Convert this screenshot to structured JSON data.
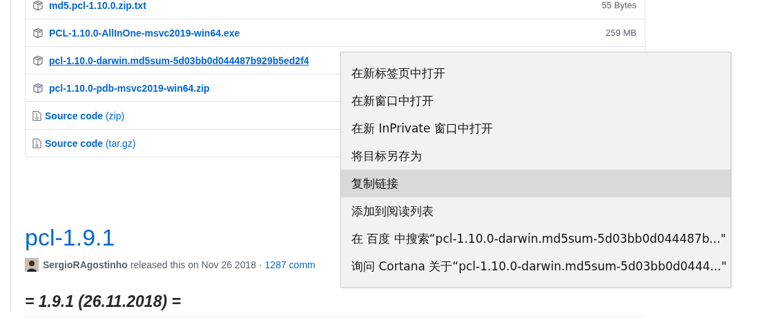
{
  "assets": [
    {
      "kind": "package",
      "name": "md5.pcl-1.10.0.zip.txt",
      "size": "55 Bytes",
      "underlined": false
    },
    {
      "kind": "package",
      "name": "PCL-1.10.0-AllInOne-msvc2019-win64.exe",
      "size": "259 MB",
      "underlined": false
    },
    {
      "kind": "package",
      "name": "pcl-1.10.0-darwin.md5sum-5d03bb0d044487b929b5ed2f4",
      "underlined": true
    },
    {
      "kind": "package",
      "name": "pcl-1.10.0-pdb-msvc2019-win64.zip",
      "underlined": false
    },
    {
      "kind": "source",
      "name": "Source code",
      "format": "(zip)",
      "underlined": false
    },
    {
      "kind": "source",
      "name": "Source code",
      "format": "(tar.gz)",
      "underlined": false
    }
  ],
  "release": {
    "title": "pcl-1.9.1",
    "author": "SergioRAgostinho",
    "released": "released this on Nov 26 2018 ·",
    "commits": "1287 comm",
    "heading": "= 1.9.1 (26.11.2018) ="
  },
  "context_menu": [
    {
      "label": "在新标签页中打开",
      "selected": false
    },
    {
      "label": "在新窗口中打开",
      "selected": false
    },
    {
      "label": "在新 InPrivate 窗口中打开",
      "selected": false
    },
    {
      "label": "将目标另存为",
      "selected": false
    },
    {
      "label": "复制链接",
      "selected": true
    },
    {
      "label": "添加到阅读列表",
      "selected": false
    },
    {
      "label": "在 百度 中搜索“pcl-1.10.0-darwin.md5sum-5d03bb0d044487b...\"",
      "selected": false
    },
    {
      "label": "询问 Cortana 关于“pcl-1.10.0-darwin.md5sum-5d03bb0d0444...\"",
      "selected": false
    }
  ]
}
